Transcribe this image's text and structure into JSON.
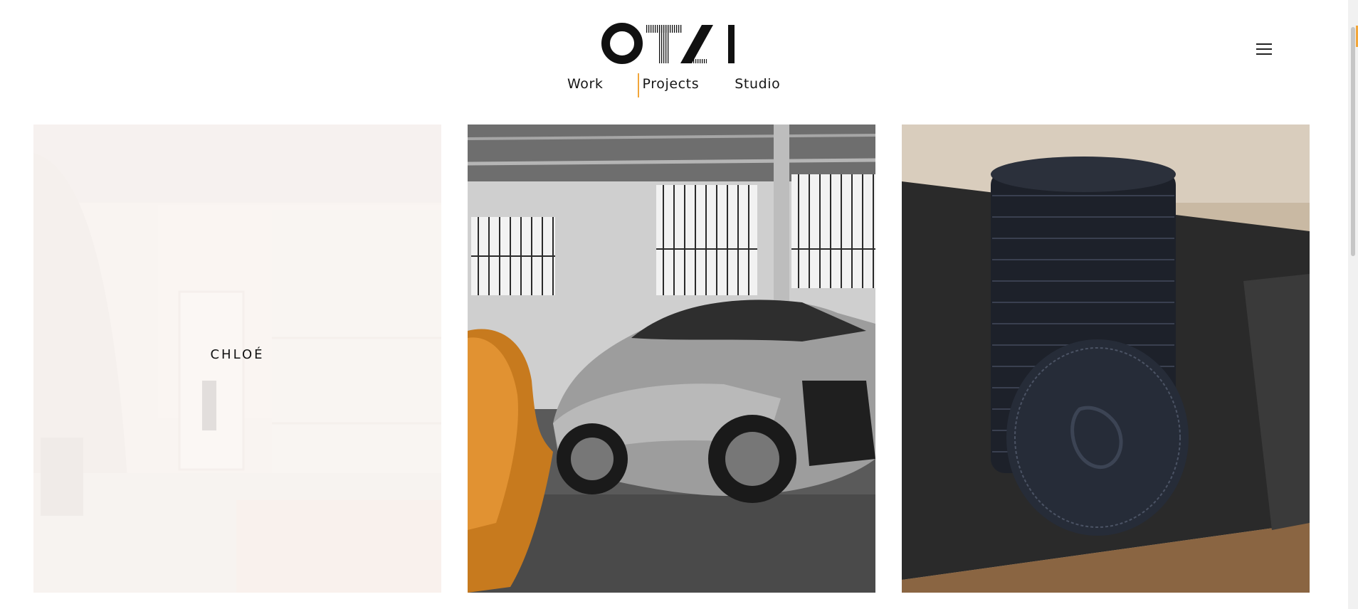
{
  "brand": {
    "logo_icon": "otzi-logo-icon"
  },
  "nav": {
    "items": [
      {
        "label": "Work"
      },
      {
        "label": "Projects"
      },
      {
        "label": "Studio"
      }
    ],
    "active": "Projects",
    "accent_color": "#f2a63a"
  },
  "menu": {
    "icon": "hamburger-menu-icon"
  },
  "projects": [
    {
      "label": "CHLOÉ",
      "image": "boutique-interior-image",
      "hovered": true
    },
    {
      "image": "sports-car-garage-image"
    },
    {
      "image": "leather-coaster-stack-image"
    }
  ]
}
